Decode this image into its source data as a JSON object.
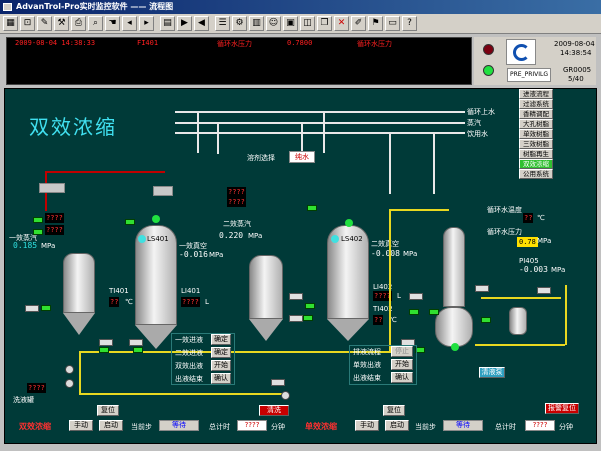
{
  "window": {
    "title": "AdvanTrol-Pro实时监控软件 —— 流程图"
  },
  "toolbar": {
    "icons": [
      "app",
      "open",
      "edit",
      "tool",
      "print",
      "search",
      "hand",
      "prev",
      "next",
      "grid",
      "fwd",
      "back",
      "list",
      "config",
      "graph",
      "stop",
      "close",
      "help"
    ]
  },
  "alarm": {
    "date_time": "2009-08-04 14:38:33",
    "tag": "FI401",
    "desc": "循环水压力",
    "value": "0.7800",
    "status": "循环水压力"
  },
  "status_panel": {
    "date": "2009-08-04",
    "time": "14:38:54",
    "user": "PRE_PRIVILG",
    "code": "GR0005",
    "page": "5/40"
  },
  "main": {
    "title": "双效浓缩",
    "legend": {
      "water": "循环上水",
      "steam": "蒸汽",
      "drink": "饮用水"
    },
    "menu": [
      "进液流程",
      "过滤系统",
      "香精调配",
      "大孔树脂",
      "单效树脂",
      "三效树脂",
      "树脂再生",
      "双效浓缩",
      "公用系统"
    ],
    "mode_label": "溶剂选择",
    "mode_value": "纯水",
    "tags": {
      "stage1_steam": "一效蒸汽",
      "stage1_steam_val": "0.185",
      "stage1_steam_unit": "MPa",
      "stage1_vac": "一效真空",
      "stage1_vac_val": "-0.016",
      "stage1_vac_unit": "MPa",
      "stage2_steam": "二效蒸汽",
      "stage2_steam_val": "0.220",
      "stage2_steam_unit": "MPa",
      "stage2_vac": "二效真空",
      "stage2_vac_val": "-0.008",
      "stage2_vac_unit": "MPa",
      "ti401": "TI401",
      "ti401_val": "??",
      "ti401_unit": "℃",
      "li401": "LI401",
      "li401_val": "????",
      "li401_unit": "L",
      "li402": "LI402",
      "li402_val": "????",
      "li402_unit": "L",
      "ti402": "TI402",
      "ti402_val": "??",
      "ti402_unit": "℃",
      "cw_temp": "循环水温度",
      "cw_temp_val": "??",
      "cw_temp_unit": "℃",
      "cw_press": "循环水压力",
      "cw_press_val": "0.78",
      "cw_press_unit": "MPa",
      "pi405": "PI405",
      "pi405_val": "-0.003",
      "pi405_unit": "MPa",
      "ls401": "LS401",
      "ls402": "LS402",
      "unknown": "????"
    },
    "controls_left": [
      {
        "label": "一效进液",
        "btn": "确定"
      },
      {
        "label": "二效进液",
        "btn": "确定"
      },
      {
        "label": "双效出液",
        "btn": "开始"
      },
      {
        "label": "出液结束",
        "btn": "确认"
      }
    ],
    "controls_right": [
      {
        "label": "排液流程",
        "btn": "停止"
      },
      {
        "label": "单效出液",
        "btn": "开始"
      },
      {
        "label": "出液结束",
        "btn": "确认"
      }
    ],
    "wash_tank": "洗液罐",
    "wash_val": "????",
    "reset": "复位",
    "clean_btn": "清洗",
    "alarm_btn": "报警复位",
    "pump_btn": "清液泵"
  },
  "bottom": {
    "left": {
      "title": "双效浓缩",
      "manual": "手动",
      "start": "启动",
      "step_label": "当前步",
      "step_val": "等待",
      "time_label": "总计时",
      "time_val": "????",
      "unit": "分钟"
    },
    "right": {
      "title": "单效浓缩",
      "manual": "手动",
      "start": "启动",
      "step_label": "当前步",
      "step_val": "等待",
      "time_label": "总计时",
      "time_val": "????",
      "unit": "分钟"
    }
  },
  "colors": {
    "background": "#003a38",
    "pipe_water": "#e8d820",
    "pipe_steam": "#e8e8e8",
    "alarm_text": "#ff2020",
    "run_green": "#30e030"
  }
}
